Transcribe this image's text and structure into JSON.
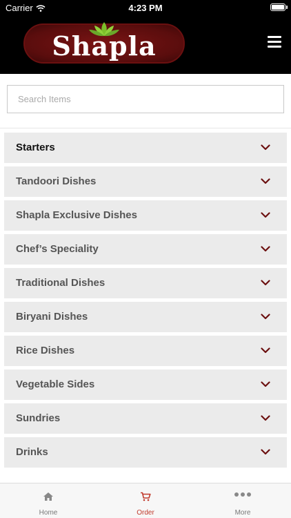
{
  "status_bar": {
    "carrier": "Carrier",
    "time": "4:23 PM"
  },
  "header": {
    "logo_text": "Shapla"
  },
  "search": {
    "placeholder": "Search Items",
    "value": ""
  },
  "categories": [
    {
      "label": "Starters"
    },
    {
      "label": "Tandoori Dishes"
    },
    {
      "label": "Shapla Exclusive Dishes"
    },
    {
      "label": "Chef’s Speciality"
    },
    {
      "label": "Traditional Dishes"
    },
    {
      "label": "Biryani Dishes"
    },
    {
      "label": "Rice Dishes"
    },
    {
      "label": "Vegetable Sides"
    },
    {
      "label": "Sundries"
    },
    {
      "label": "Drinks"
    }
  ],
  "tabbar": {
    "tabs": [
      {
        "label": "Home",
        "icon": "home-icon"
      },
      {
        "label": "Order",
        "icon": "cart-icon",
        "active": true
      },
      {
        "label": "More",
        "icon": "more-icon"
      }
    ]
  },
  "colors": {
    "accent": "#c0392b",
    "chevron": "#6b0f0f",
    "header_bg": "#000000",
    "logo_bg": "#6b1010"
  }
}
